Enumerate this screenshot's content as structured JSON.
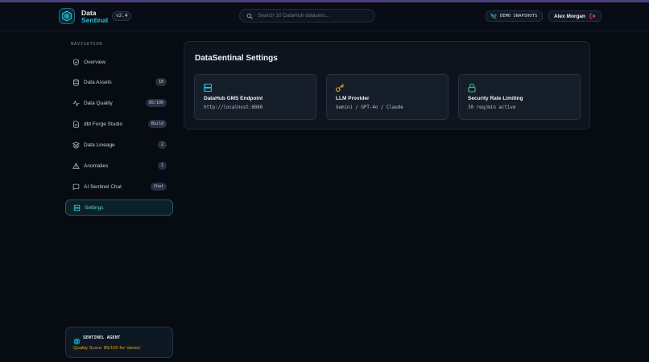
{
  "app": {
    "name_line1": "Data",
    "name_line2": "Sentinal",
    "version": "v2.4"
  },
  "header": {
    "search_placeholder": "Search 10 DataHub datasets...",
    "demo_label": "DEMO SNAPSHOTS",
    "user_name": "Alex Morgan"
  },
  "sidebar": {
    "heading": "NAVIGATION",
    "items": [
      {
        "label": "Overview",
        "icon": "shield-icon",
        "badge": ""
      },
      {
        "label": "Data Assets",
        "icon": "database-icon",
        "badge": "10"
      },
      {
        "label": "Data Quality",
        "icon": "activity-icon",
        "badge": "85/100"
      },
      {
        "label": "dbt Forge Studio",
        "icon": "file-code-icon",
        "badge": "Build"
      },
      {
        "label": "Data Lineage",
        "icon": "layers-icon",
        "badge": "2"
      },
      {
        "label": "Anomalies",
        "icon": "alert-triangle-icon",
        "badge": "1"
      },
      {
        "label": "AI Sentinel Chat",
        "icon": "message-square-icon",
        "badge": "Chat"
      },
      {
        "label": "Settings",
        "icon": "server-icon",
        "badge": "",
        "active": true
      }
    ]
  },
  "settings": {
    "title": "DataSentinal Settings",
    "cards": [
      {
        "title": "DataHub GMS Endpoint",
        "value": "http://localhost:8080",
        "icon": "server-icon",
        "color": "#22c3dc"
      },
      {
        "title": "LLM Provider",
        "value": "Gemini / GPT-4o / Claude",
        "icon": "key-icon",
        "color": "#e5a324"
      },
      {
        "title": "Security Rate Limiting",
        "value": "30 req/min active",
        "icon": "lock-icon",
        "color": "#2fd08a"
      }
    ]
  },
  "agent": {
    "title": "SENTINEL AGENT",
    "score_text": "Quality Score: 85/100 for 'stores'"
  },
  "colors": {
    "accent": "#22c3dc",
    "warning": "#e5a324",
    "success": "#2fd08a",
    "background": "#070b12"
  }
}
